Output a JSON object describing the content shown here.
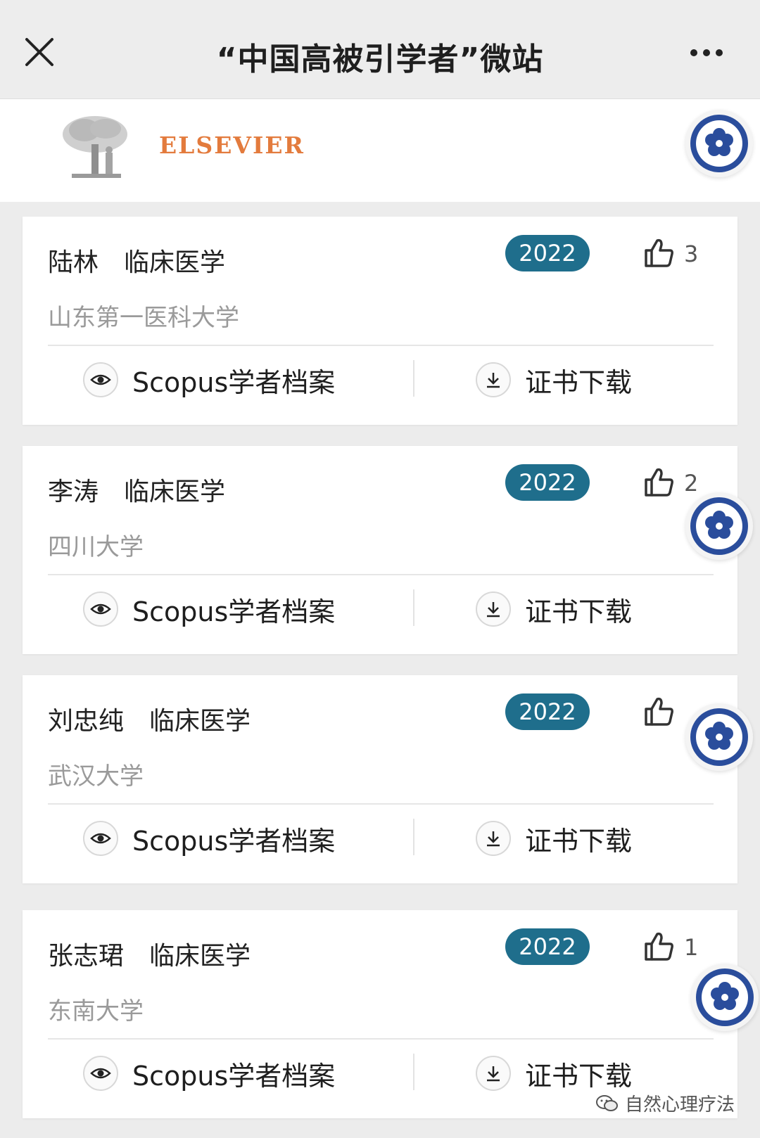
{
  "header": {
    "title": "“中国高被引学者”微站"
  },
  "brand": {
    "name": "ELSEVIER"
  },
  "cards": [
    {
      "name": "陆林",
      "field": "临床医学",
      "university": "山东第一医科大学",
      "year": "2022",
      "likes": "3",
      "scopus_label": "Scopus学者档案",
      "cert_label": "证书下载"
    },
    {
      "name": "李涛",
      "field": "临床医学",
      "university": "四川大学",
      "year": "2022",
      "likes": "2",
      "scopus_label": "Scopus学者档案",
      "cert_label": "证书下载"
    },
    {
      "name": "刘忠纯",
      "field": "临床医学",
      "university": "武汉大学",
      "year": "2022",
      "likes": "",
      "scopus_label": "Scopus学者档案",
      "cert_label": "证书下载"
    },
    {
      "name": "张志珺",
      "field": "临床医学",
      "university": "东南大学",
      "year": "2022",
      "likes": "1",
      "scopus_label": "Scopus学者档案",
      "cert_label": "证书下载"
    }
  ],
  "watermark": {
    "text": "自然心理疗法"
  },
  "icons": {
    "close": "close-icon",
    "more": "more-icon",
    "like": "thumbs-up-icon",
    "view": "eye-icon",
    "download": "download-icon",
    "seal": "cas-seal-icon"
  },
  "colors": {
    "badge": "#1f6e8c",
    "brand": "#e37b3d",
    "seal": "#2a4d9c"
  }
}
